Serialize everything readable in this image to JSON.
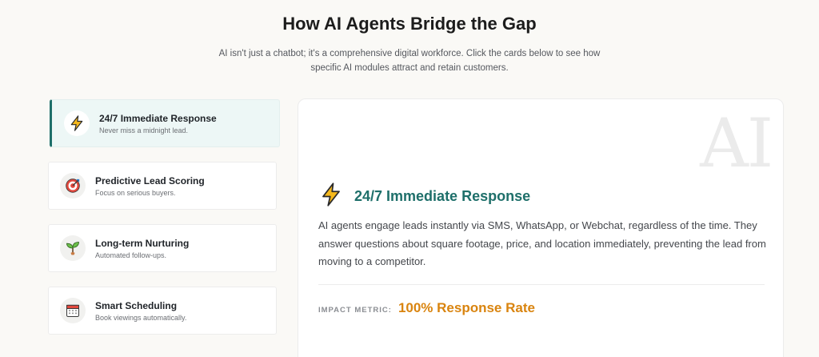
{
  "header": {
    "title": "How AI Agents Bridge the Gap",
    "subtitle": "AI isn't just a chatbot; it's a comprehensive digital workforce. Click the cards below to see how specific AI modules attract and retain customers."
  },
  "cards": [
    {
      "title": "24/7 Immediate Response",
      "desc": "Never miss a midnight lead.",
      "icon": "lightning-icon",
      "active": true
    },
    {
      "title": "Predictive Lead Scoring",
      "desc": "Focus on serious buyers.",
      "icon": "target-icon",
      "active": false
    },
    {
      "title": "Long-term Nurturing",
      "desc": "Automated follow-ups.",
      "icon": "seedling-icon",
      "active": false
    },
    {
      "title": "Smart Scheduling",
      "desc": "Book viewings automatically.",
      "icon": "calendar-icon",
      "active": false
    }
  ],
  "detail": {
    "watermark": "AI",
    "icon": "lightning-icon",
    "title": "24/7 Immediate Response",
    "body": "AI agents engage leads instantly via SMS, WhatsApp, or Webchat, regardless of the time. They answer questions about square footage, price, and location immediately, preventing the lead from moving to a competitor.",
    "metric_label": "IMPACT METRIC:",
    "metric_value": "100% Response Rate"
  },
  "colors": {
    "accent": "#1e6f6a",
    "metric": "#d9840f",
    "active_card_bg": "#edf7f6",
    "background": "#faf9f6"
  }
}
